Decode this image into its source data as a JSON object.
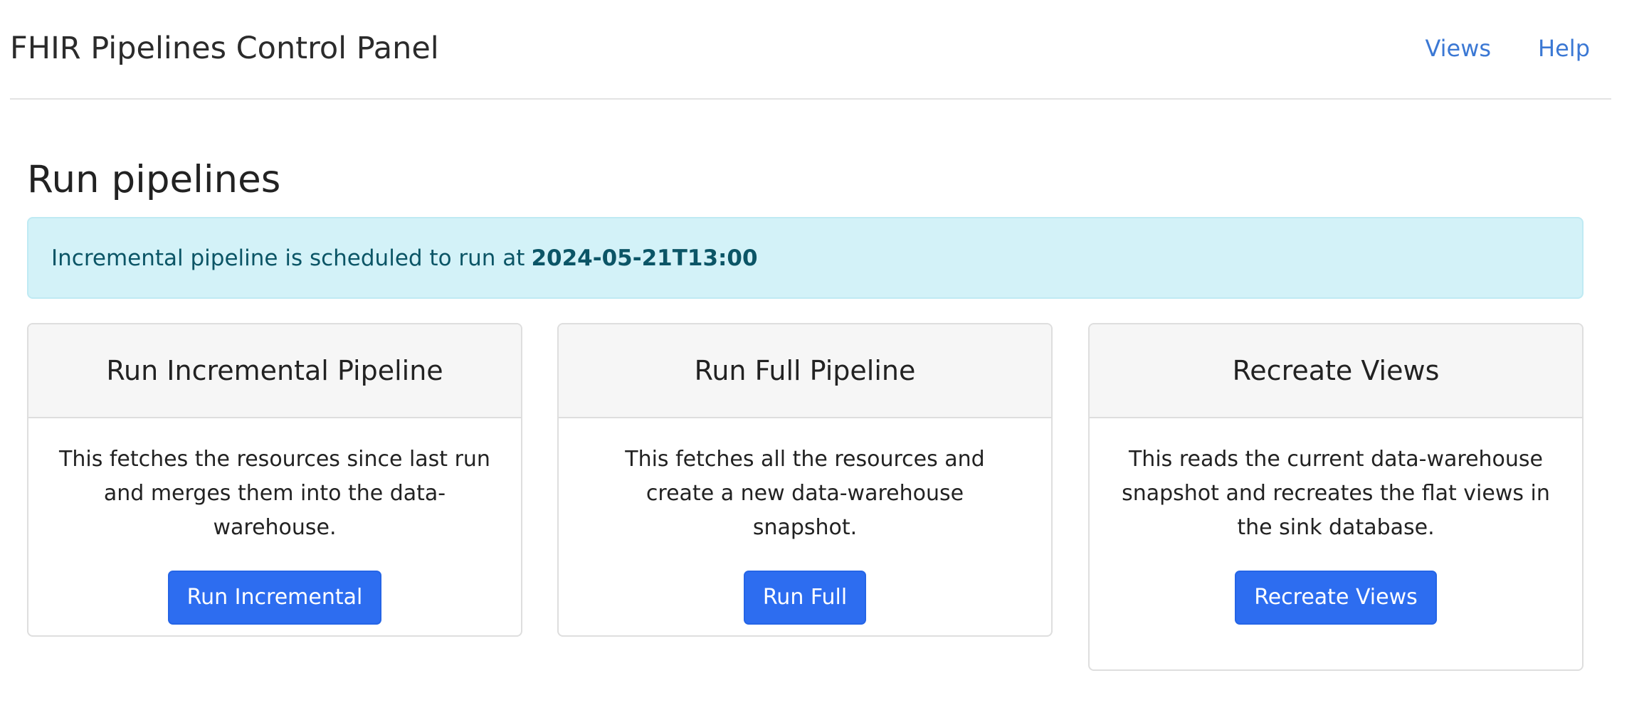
{
  "navbar": {
    "brand": "FHIR Pipelines Control Panel",
    "links": [
      {
        "label": "Views"
      },
      {
        "label": "Help"
      }
    ]
  },
  "page": {
    "title": "Run pipelines"
  },
  "alert": {
    "text": "Incremental pipeline is scheduled to run at",
    "datetime": "2024-05-21T13:00"
  },
  "cards": [
    {
      "title": "Run Incremental Pipeline",
      "description": "This fetches the resources since last run and merges them into the data-warehouse.",
      "button_label": "Run Incremental"
    },
    {
      "title": "Run Full Pipeline",
      "description": "This fetches all the resources and create a new data-warehouse snapshot.",
      "button_label": "Run Full"
    },
    {
      "title": "Recreate Views",
      "description": "This reads the current data-warehouse snapshot and recreates the flat views in the sink database.",
      "button_label": "Recreate Views"
    }
  ],
  "colors": {
    "primary": "#2d6df0",
    "link": "#3b78d4",
    "alert_bg": "#d3f2f8",
    "alert_text": "#0b5566"
  }
}
